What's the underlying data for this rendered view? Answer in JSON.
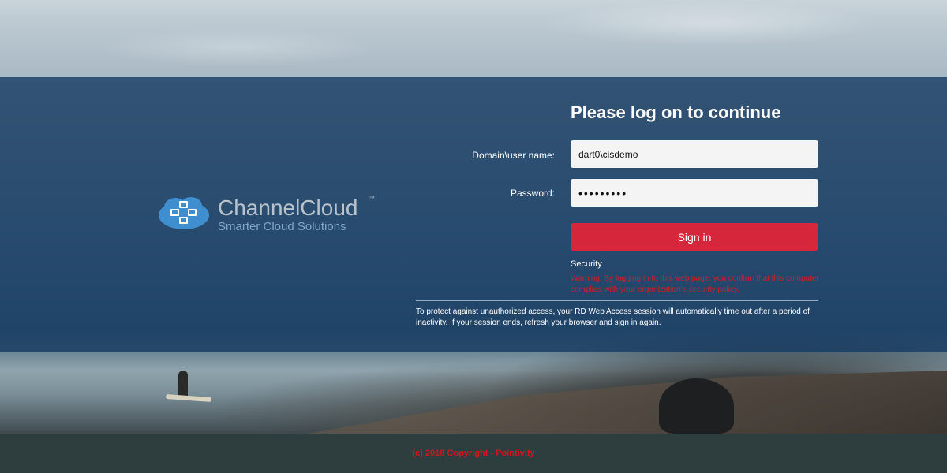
{
  "logo": {
    "name": "ChannelCloud",
    "trademark": "™",
    "tagline": "Smarter Cloud Solutions"
  },
  "login": {
    "title": "Please log on to continue",
    "username_label": "Domain\\user name:",
    "username_value": "dart0\\cisdemo",
    "password_label": "Password:",
    "password_value": "•••••••••",
    "signin_label": "Sign in"
  },
  "security": {
    "heading": "Security",
    "warning": "Warning: By logging in to this web page, you confirm that this computer complies with your organization's security policy.",
    "timeout_notice": "To protect against unauthorized access, your RD Web Access session will automatically time out after a period of inactivity. If your session ends, refresh your browser and sign in again."
  },
  "footer": {
    "copyright": "(c) 2018 Copyright - Pointivity"
  },
  "colors": {
    "overlay": "#153a60",
    "signin_button": "#d5263b",
    "warning_text": "#c8202c",
    "footer": "#2e3d3e"
  }
}
